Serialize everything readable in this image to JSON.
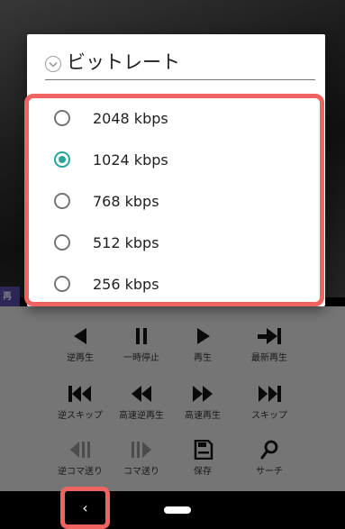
{
  "dialog": {
    "title": "ビットレート",
    "options": [
      {
        "label": "2048 kbps",
        "selected": false
      },
      {
        "label": "1024 kbps",
        "selected": true
      },
      {
        "label": "768 kbps",
        "selected": false
      },
      {
        "label": "512 kbps",
        "selected": false
      },
      {
        "label": "256 kbps",
        "selected": false
      }
    ]
  },
  "video": {
    "overlay_label": "再"
  },
  "controls": {
    "row1": [
      {
        "label": "逆再生",
        "icon": "reverse-play-icon"
      },
      {
        "label": "一時停止",
        "icon": "pause-icon"
      },
      {
        "label": "再生",
        "icon": "play-icon"
      },
      {
        "label": "最新再生",
        "icon": "latest-play-icon"
      }
    ],
    "row2": [
      {
        "label": "逆スキップ",
        "icon": "skip-back-icon"
      },
      {
        "label": "高速逆再生",
        "icon": "fast-rewind-icon"
      },
      {
        "label": "高速再生",
        "icon": "fast-forward-icon"
      },
      {
        "label": "スキップ",
        "icon": "skip-forward-icon"
      }
    ],
    "row3": [
      {
        "label": "逆コマ送り",
        "icon": "frame-back-icon",
        "enabled": false
      },
      {
        "label": "コマ送り",
        "icon": "frame-forward-icon",
        "enabled": false
      },
      {
        "label": "保存",
        "icon": "save-icon",
        "enabled": true
      },
      {
        "label": "サーチ",
        "icon": "search-icon",
        "enabled": true
      }
    ]
  },
  "navbar": {
    "back_label": "‹"
  },
  "colors": {
    "accent": "#26a69a",
    "highlight": "#ef6461",
    "panel": "#bdbdbd"
  }
}
